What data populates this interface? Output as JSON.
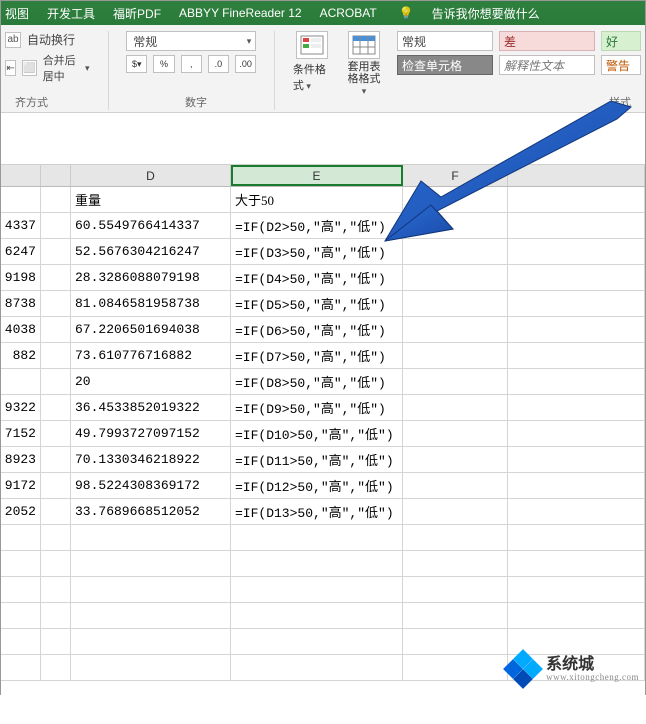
{
  "menu": {
    "items": [
      "视图",
      "开发工具",
      "福昕PDF",
      "ABBYY FineReader 12",
      "ACROBAT"
    ],
    "tell_me": "告诉我你想要做什么"
  },
  "ribbon": {
    "wrap_text": "自动换行",
    "merge_center": "合并后居中",
    "align_group": "齐方式",
    "number_format_selected": "常规",
    "number_group": "数字",
    "cond_format": "条件格式",
    "table_format": "套用表格格式",
    "style_normal": "常规",
    "style_bad": "差",
    "style_good": "好",
    "style_check": "检查单元格",
    "style_explain": "解释性文本",
    "style_warn": "警告",
    "styles_group": "样式"
  },
  "columns": {
    "D": "D",
    "E": "E",
    "F": "F"
  },
  "headers": {
    "weight": "重量",
    "gt50": "大于50"
  },
  "rows": [
    {
      "c_tail": "4337",
      "d": "60.5549766414337",
      "e": "=IF(D2>50,\"高\",\"低\")"
    },
    {
      "c_tail": "6247",
      "d": "52.5676304216247",
      "e": "=IF(D3>50,\"高\",\"低\")"
    },
    {
      "c_tail": "9198",
      "d": "28.3286088079198",
      "e": "=IF(D4>50,\"高\",\"低\")"
    },
    {
      "c_tail": "8738",
      "d": "81.0846581958738",
      "e": "=IF(D5>50,\"高\",\"低\")"
    },
    {
      "c_tail": "4038",
      "d": "67.2206501694038",
      "e": "=IF(D6>50,\"高\",\"低\")"
    },
    {
      "c_tail": "882",
      "d": "73.610776716882",
      "e": "=IF(D7>50,\"高\",\"低\")"
    },
    {
      "c_tail": "",
      "d": "20",
      "e": "=IF(D8>50,\"高\",\"低\")"
    },
    {
      "c_tail": "9322",
      "d": "36.4533852019322",
      "e": "=IF(D9>50,\"高\",\"低\")"
    },
    {
      "c_tail": "7152",
      "d": "49.7993727097152",
      "e": "=IF(D10>50,\"高\",\"低\")"
    },
    {
      "c_tail": "8923",
      "d": "70.1330346218922",
      "e": "=IF(D11>50,\"高\",\"低\")"
    },
    {
      "c_tail": "9172",
      "d": "98.5224308369172",
      "e": "=IF(D12>50,\"高\",\"低\")"
    },
    {
      "c_tail": "2052",
      "d": "33.7689668512052",
      "e": "=IF(D13>50,\"高\",\"低\")"
    }
  ],
  "watermark": {
    "title": "系统城",
    "url": "www.xitongcheng.com"
  }
}
